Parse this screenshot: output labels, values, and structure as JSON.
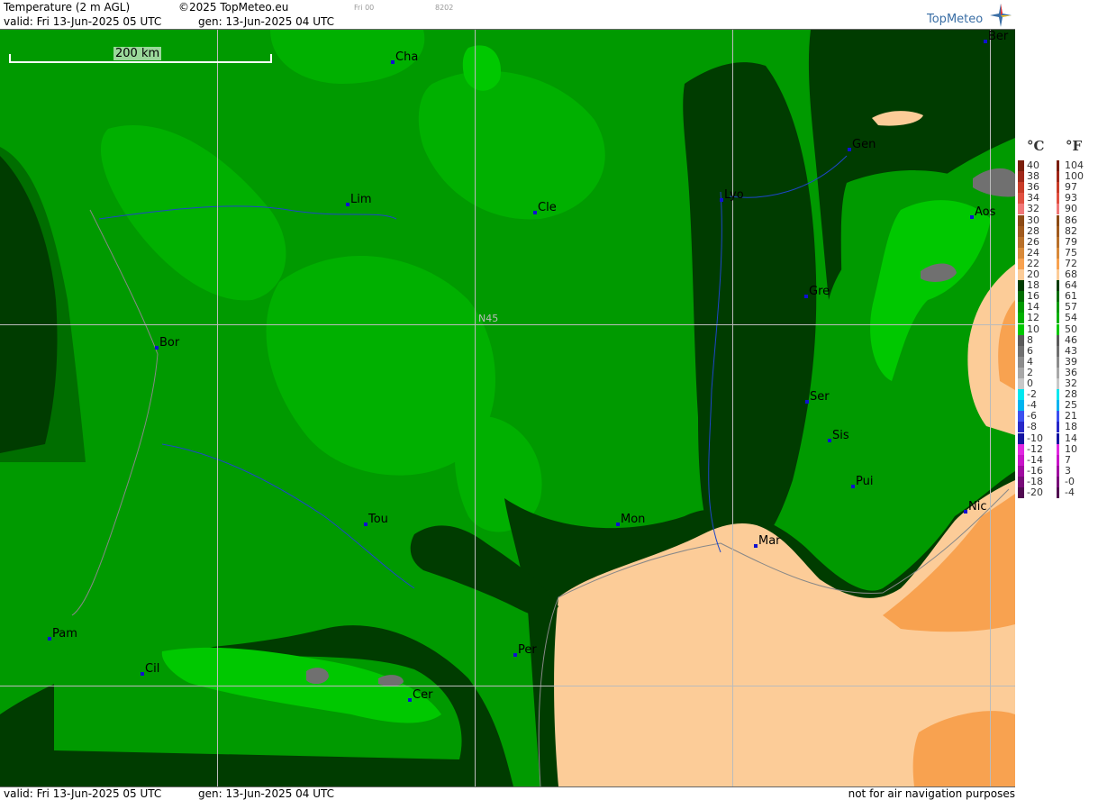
{
  "header": {
    "title": "Temperature (2 m AGL)",
    "copyright": "©2025 TopMeteo.eu",
    "run_label": "Fri 00",
    "code": "8202",
    "valid": "valid:  Fri  13-Jun-2025  05 UTC",
    "gen": "gen: 13-Jun-2025 04 UTC",
    "logo_text": "TopMeteo"
  },
  "map": {
    "scale_label": "200 km",
    "grid_label": "N45",
    "cities": [
      "Cha",
      "Lim",
      "Cle",
      "Lyo",
      "Gen",
      "Ber",
      "Aos",
      "Gre",
      "Bor",
      "Ser",
      "Sis",
      "Pui",
      "Nic",
      "Mar",
      "Mon",
      "Tou",
      "Pam",
      "Cil",
      "Cer",
      "Per"
    ],
    "colors": {
      "t12": "#00c800",
      "t14": "#00b000",
      "t16": "#009a00",
      "t18": "#006e00",
      "t20": "#003c00",
      "t22": "#fccc98",
      "t24": "#f8a250",
      "t2": "#707070",
      "coast": "#1e46c8"
    }
  },
  "footer": {
    "valid": "valid:  Fri  13-Jun-2025  05 UTC",
    "gen": "gen: 13-Jun-2025 04 UTC",
    "disclaimer": "not for air navigation purposes"
  },
  "legend": {
    "celsius_unit": "°C",
    "fahrenheit_unit": "°F",
    "celsius": [
      "40",
      "38",
      "36",
      "34",
      "32",
      "30",
      "28",
      "26",
      "24",
      "22",
      "20",
      "18",
      "16",
      "14",
      "12",
      "10",
      "8",
      "6",
      "4",
      "2",
      "0",
      "-2",
      "-4",
      "-6",
      "-8",
      "-10",
      "-12",
      "-14",
      "-16",
      "-18",
      "-20"
    ],
    "fahrenheit": [
      "104",
      "100",
      "97",
      "93",
      "90",
      "86",
      "82",
      "79",
      "75",
      "72",
      "68",
      "64",
      "61",
      "57",
      "54",
      "50",
      "46",
      "43",
      "39",
      "36",
      "32",
      "28",
      "25",
      "21",
      "18",
      "14",
      "10",
      "7",
      "3",
      "-0",
      "-4"
    ],
    "colors": [
      "#7a1e0a",
      "#a0281a",
      "#c83c28",
      "#e05040",
      "#f07878",
      "#8c4a14",
      "#a05a1e",
      "#b8702a",
      "#d88a3a",
      "#f8a250",
      "#fccc98",
      "#003c00",
      "#006e00",
      "#009a00",
      "#00b000",
      "#00c800",
      "#5a5a5a",
      "#707070",
      "#8c8c8c",
      "#a8a8a8",
      "#c8c8c8",
      "#00e8f0",
      "#00b4f0",
      "#3c50f0",
      "#2828c8",
      "#1414a0",
      "#e028e0",
      "#c814c8",
      "#a00aa0",
      "#780a78",
      "#500a50"
    ]
  }
}
